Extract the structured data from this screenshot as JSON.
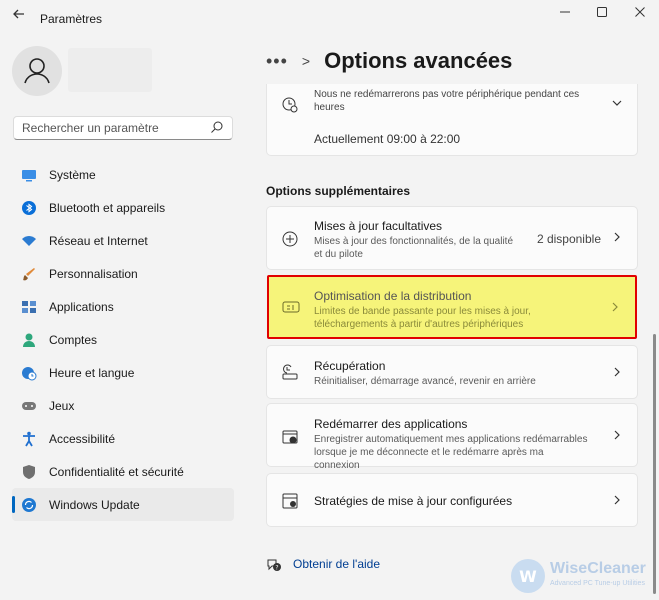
{
  "window": {
    "title": "Paramètres",
    "back_icon": "back-arrow-icon",
    "controls": [
      "minimize-icon",
      "maximize-icon",
      "close-icon"
    ]
  },
  "search": {
    "placeholder": "Rechercher un paramètre"
  },
  "sidebar": {
    "items": [
      {
        "label": "Système",
        "icon": "system-icon",
        "color": "#3a8ee6"
      },
      {
        "label": "Bluetooth et appareils",
        "icon": "bluetooth-icon",
        "color": "#0a6fd8"
      },
      {
        "label": "Réseau et Internet",
        "icon": "wifi-icon",
        "color": "#2a7bd1"
      },
      {
        "label": "Personnalisation",
        "icon": "brush-icon",
        "color": "#e08a3a"
      },
      {
        "label": "Applications",
        "icon": "apps-icon",
        "color": "#3a6fb0"
      },
      {
        "label": "Comptes",
        "icon": "account-icon",
        "color": "#2ea77c"
      },
      {
        "label": "Heure et langue",
        "icon": "globe-clock-icon",
        "color": "#2a7bd1"
      },
      {
        "label": "Jeux",
        "icon": "gamepad-icon",
        "color": "#777777"
      },
      {
        "label": "Accessibilité",
        "icon": "accessibility-icon",
        "color": "#1f6fcf"
      },
      {
        "label": "Confidentialité et sécurité",
        "icon": "shield-icon",
        "color": "#6f6f6f"
      },
      {
        "label": "Windows Update",
        "icon": "update-icon",
        "color": "#1f78d1",
        "active": true
      }
    ]
  },
  "breadcrumb": {
    "title": "Options avancées"
  },
  "active_hours": {
    "text": "Nous ne redémarrerons pas votre périphérique pendant ces heures",
    "current": "Actuellement 09:00 à 22:00"
  },
  "section": {
    "title": "Options supplémentaires"
  },
  "options": [
    {
      "title": "Mises à jour facultatives",
      "subtitle": "Mises à jour des fonctionnalités, de la qualité et du pilote",
      "value": "2 disponible",
      "icon": "plus-circle-icon"
    },
    {
      "title": "Optimisation de la distribution",
      "subtitle": "Limites de bande passante pour les mises à jour, téléchargements à partir d'autres périphériques",
      "icon": "delivery-optimization-icon",
      "highlight_color": "#f6f47a",
      "border_color": "#e10000"
    },
    {
      "title": "Récupération",
      "subtitle": "Réinitialiser, démarrage avancé, revenir en arrière",
      "icon": "recovery-icon"
    },
    {
      "title": "Redémarrer des applications",
      "subtitle": "Enregistrer automatiquement mes applications redémarrables lorsque je me déconnecte et le redémarre après ma connexion",
      "icon": "restart-apps-icon"
    },
    {
      "title": "Stratégies de mise à jour configurées",
      "icon": "policy-icon"
    }
  ],
  "help": {
    "label": "Obtenir de l'aide",
    "icon": "help-icon"
  },
  "watermark": {
    "name": "WiseCleaner",
    "tagline": "Advanced PC Tune-up Utilities"
  }
}
